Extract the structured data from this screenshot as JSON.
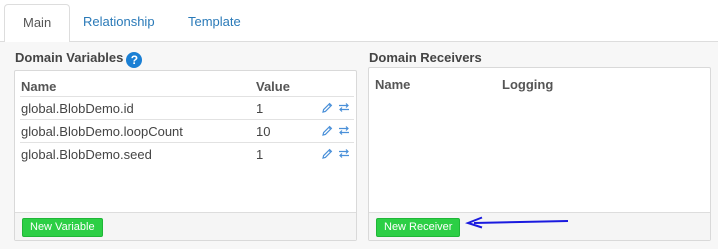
{
  "tabs": [
    {
      "label": "Main",
      "active": true
    },
    {
      "label": "Relationship",
      "active": false
    },
    {
      "label": "Template",
      "active": false
    }
  ],
  "domain_variables": {
    "title": "Domain Variables",
    "help_icon": "question-circle-icon",
    "columns": {
      "name": "Name",
      "value": "Value"
    },
    "rows": [
      {
        "name": "global.BlobDemo.id",
        "value": "1"
      },
      {
        "name": "global.BlobDemo.loopCount",
        "value": "10"
      },
      {
        "name": "global.BlobDemo.seed",
        "value": "1"
      }
    ],
    "row_icons": [
      "pencil-edit-icon",
      "swap-arrows-icon"
    ],
    "add_button": "New Variable"
  },
  "domain_receivers": {
    "title": "Domain Receivers",
    "columns": {
      "name": "Name",
      "logging": "Logging"
    },
    "add_button": "New Receiver"
  },
  "colors": {
    "accent_blue": "#2a7ab8",
    "button_green": "#2ccf45",
    "annotation_arrow": "#1a1adf"
  }
}
